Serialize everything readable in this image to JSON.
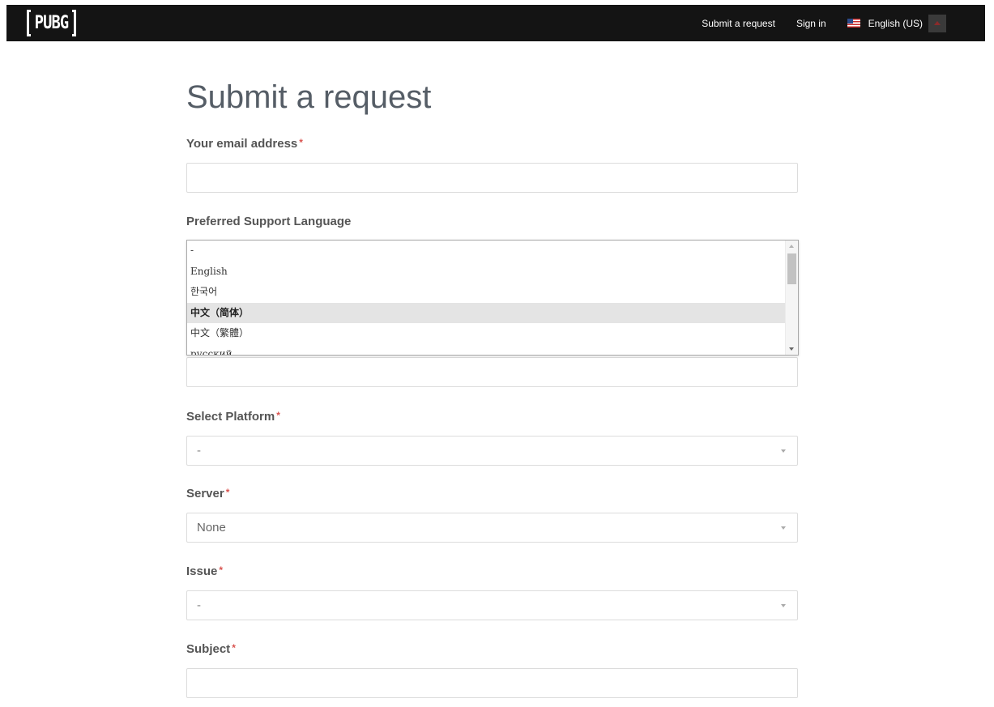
{
  "header": {
    "logo_text": "PUBG",
    "nav": {
      "submit_request": "Submit a request",
      "sign_in": "Sign in",
      "language": "English (US)"
    }
  },
  "form": {
    "title": "Submit a request",
    "email": {
      "label": "Your email address",
      "required": "*",
      "value": ""
    },
    "support_language": {
      "label": "Preferred Support Language",
      "options": [
        "-",
        "English",
        "한국어",
        "中文（简体）",
        "中文（繁體）",
        "русский"
      ],
      "highlighted_index": 3
    },
    "platform": {
      "label": "Select Platform",
      "required": "*",
      "value": "-"
    },
    "server": {
      "label": "Server",
      "required": "*",
      "value": "None"
    },
    "issue": {
      "label": "Issue",
      "required": "*",
      "value": "-"
    },
    "subject": {
      "label": "Subject",
      "required": "*",
      "value": ""
    }
  },
  "colors": {
    "header_bg": "#141414",
    "required_star": "#d9534f",
    "highlight_bg": "#e4e4e4"
  }
}
